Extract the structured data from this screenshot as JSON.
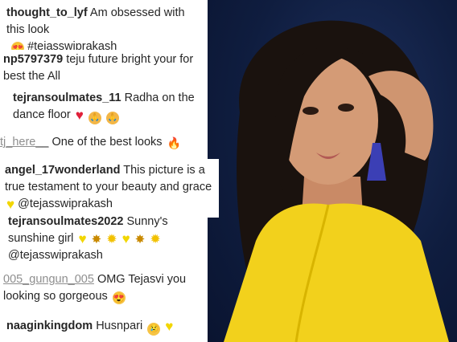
{
  "comments": [
    {
      "user": "thought_to_lyf",
      "text": "Am obsessed with this look",
      "tag": "#tejasswiprakash",
      "emojis": [
        "smiling-heart-eyes-icon"
      ]
    },
    {
      "user": "np5797379",
      "text": "teju future bright your for best the All",
      "emojis": []
    },
    {
      "user": "tejransoulmates_11",
      "text": "Radha on the dance floor",
      "emojis": [
        "red-heart-icon",
        "praying-hands-icon",
        "praying-hands-icon"
      ]
    },
    {
      "user": "tj_here__",
      "text": "One of the best looks",
      "emojis": [
        "fire-icon"
      ]
    },
    {
      "user": "angel_17wonderland",
      "text": "This picture is a true testament to your beauty and grace",
      "tag": "@tejasswiprakash",
      "emojis": [
        "yellow-heart-icon"
      ]
    },
    {
      "user": "tejransoulmates2022",
      "text": "Sunny's sunshine girl",
      "tag": "@tejasswiprakash",
      "emojis": [
        "yellow-heart-icon",
        "sparkle-icon",
        "sun-icon",
        "yellow-heart-icon",
        "sparkle-icon",
        "sun-icon"
      ]
    },
    {
      "user": "005_gungun_005",
      "text": "OMG Tejasvi you looking so gorgeous",
      "emojis": [
        "smiling-heart-eyes-icon"
      ]
    },
    {
      "user": "naaginkingdom",
      "text": "Husnpari",
      "emojis": [
        "crying-face-icon",
        "yellow-heart-icon"
      ]
    }
  ],
  "colors": {
    "photo_bg": "#0f1d3f",
    "dress": "#f2d11c",
    "earring": "#3b3fb5"
  }
}
